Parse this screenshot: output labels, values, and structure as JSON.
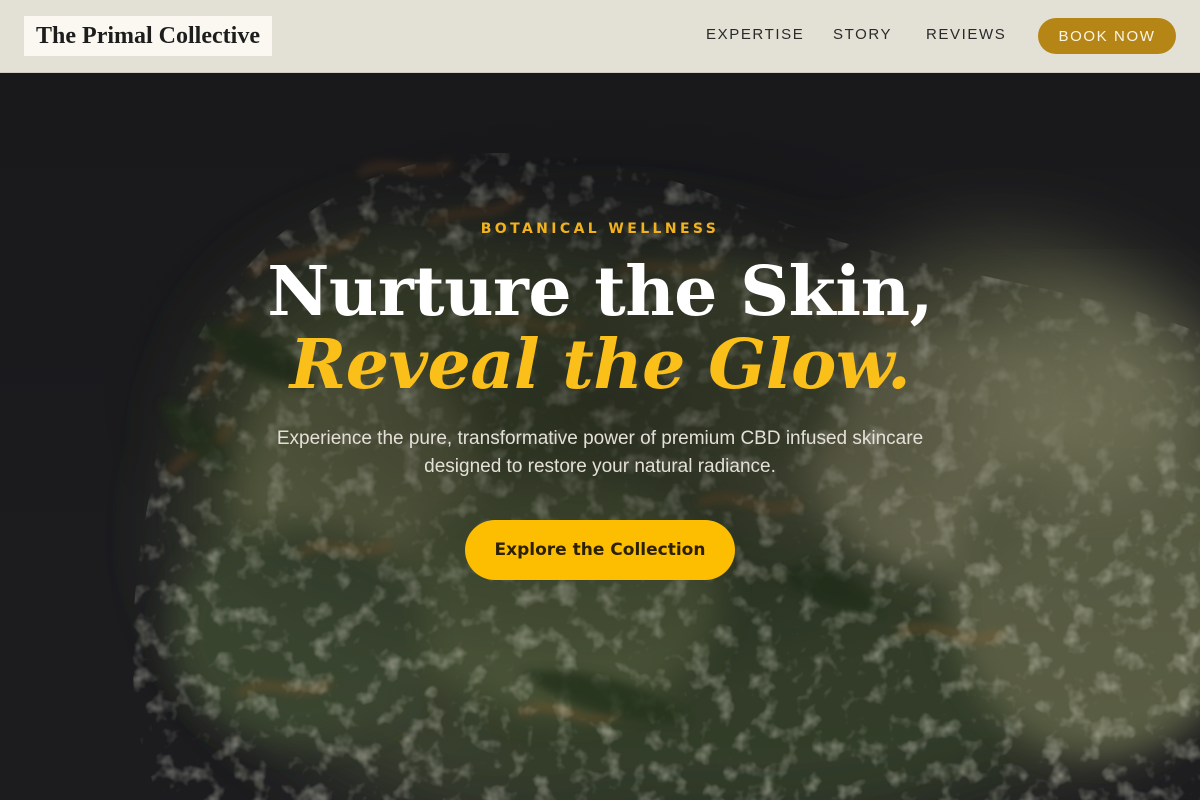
{
  "brand": {
    "name": "The Primal Collective"
  },
  "nav": {
    "items": [
      {
        "label": "EXPERTISE"
      },
      {
        "label": "STORY"
      },
      {
        "label": "REVIEWS"
      }
    ],
    "cta_label": "BOOK NOW"
  },
  "hero": {
    "eyebrow": "BOTANICAL WELLNESS",
    "headline": "Nurture the Skin,",
    "headline_accent": "Reveal the Glow.",
    "subtext": "Experience the pure, transformative power of premium CBD infused skincare designed to restore your natural radiance.",
    "cta_label": "Explore the Collection",
    "background_image": "close-up-of-cannabis-flower"
  },
  "colors": {
    "header_bg": "#e3e0d6",
    "gold": "#b58516",
    "accent_yellow": "#fbbf1a",
    "cta_yellow": "#fdbd00",
    "hero_bg": "#1c1c1e"
  }
}
